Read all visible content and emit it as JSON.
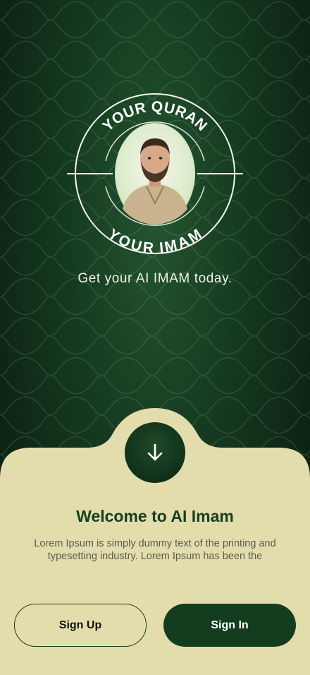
{
  "logo": {
    "top_text": "YOUR QURAN",
    "bottom_text": "YOUR IMAM",
    "portrait": "imam-portrait"
  },
  "tagline": "Get your AI IMAM today.",
  "sheet": {
    "arrow_icon": "arrow-down-icon",
    "title": "Welcome to AI Imam",
    "description": "Lorem Ipsum is simply dummy text of the printing and typesetting industry. Lorem Ipsum has been the",
    "signup_label": "Sign Up",
    "signin_label": "Sign In"
  },
  "colors": {
    "background": "#163b21",
    "sheet": "#e3ddae",
    "primary": "#143d1f"
  }
}
